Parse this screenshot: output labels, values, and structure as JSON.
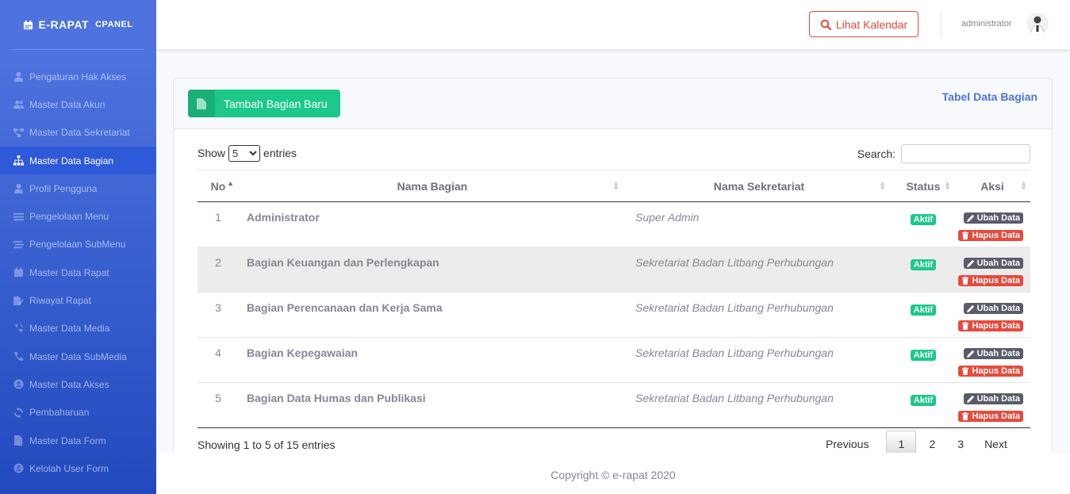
{
  "brand": {
    "title": "E-RAPAT",
    "subtitle": "CPANEL",
    "icon": "calendar-icon"
  },
  "sidebar": {
    "items": [
      {
        "label": "Pengaturan Hak Akses",
        "icon": "user-icon",
        "active": false
      },
      {
        "label": "Master Data Akun",
        "icon": "users-icon",
        "active": false
      },
      {
        "label": "Master Data Sekretariat",
        "icon": "project-diagram-icon",
        "active": false
      },
      {
        "label": "Master Data Bagian",
        "icon": "sitemap-icon",
        "active": true
      },
      {
        "label": "Profil Pengguna",
        "icon": "user-icon",
        "active": false
      },
      {
        "label": "Pengelolaan Menu",
        "icon": "bars-icon",
        "active": false
      },
      {
        "label": "Pengelolaan SubMenu",
        "icon": "stream-icon",
        "active": false
      },
      {
        "label": "Master Data Rapat",
        "icon": "calendar-icon",
        "active": false
      },
      {
        "label": "Riwayat Rapat",
        "icon": "file-signature-icon",
        "active": false
      },
      {
        "label": "Master Data Media",
        "icon": "phone-volume-icon",
        "active": false
      },
      {
        "label": "Master Data SubMedia",
        "icon": "phone-icon",
        "active": false
      },
      {
        "label": "Master Data Akses",
        "icon": "user-circle-icon",
        "active": false
      },
      {
        "label": "Pembaharuan",
        "icon": "sync-icon",
        "active": false
      },
      {
        "label": "Master Data Form",
        "icon": "file-icon",
        "active": false
      },
      {
        "label": "Kelolah User Form",
        "icon": "user-circle-icon",
        "active": false
      }
    ]
  },
  "topbar": {
    "calendar_button": "Lihat Kalendar",
    "calendar_icon": "search-icon",
    "user_name": "administrator"
  },
  "card": {
    "add_button": "Tambah Bagian Baru",
    "add_icon": "file-icon",
    "title": "Tabel Data Bagian"
  },
  "table_controls": {
    "show_label": "Show",
    "entries_label": "entries",
    "page_size": "5",
    "search_label": "Search:",
    "search_value": ""
  },
  "table": {
    "headers": [
      "No",
      "Nama Bagian",
      "Nama Sekretariat",
      "Status",
      "Aksi"
    ],
    "rows": [
      {
        "no": "1",
        "nama": "Administrator",
        "sekretariat": "Super Admin",
        "status": "Aktif"
      },
      {
        "no": "2",
        "nama": "Bagian Keuangan dan Perlengkapan",
        "sekretariat": "Sekretariat Badan Litbang Perhubungan",
        "status": "Aktif"
      },
      {
        "no": "3",
        "nama": "Bagian Perencanaan dan Kerja Sama",
        "sekretariat": "Sekretariat Badan Litbang Perhubungan",
        "status": "Aktif"
      },
      {
        "no": "4",
        "nama": "Bagian Kepegawaian",
        "sekretariat": "Sekretariat Badan Litbang Perhubungan",
        "status": "Aktif"
      },
      {
        "no": "5",
        "nama": "Bagian Data Humas dan Publikasi",
        "sekretariat": "Sekretariat Badan Litbang Perhubungan",
        "status": "Aktif"
      }
    ],
    "edit_label": "Ubah Data",
    "delete_label": "Hapus Data"
  },
  "pagination": {
    "info": "Showing 1 to 5 of 15 entries",
    "previous": "Previous",
    "pages": [
      "1",
      "2",
      "3"
    ],
    "current": "1",
    "next": "Next"
  },
  "footer": {
    "copyright": "Copyright © e-rapat 2020"
  },
  "colors": {
    "primary": "#4e73df",
    "success": "#1cc88a",
    "danger": "#e74a3b",
    "dark": "#5a5c69"
  }
}
